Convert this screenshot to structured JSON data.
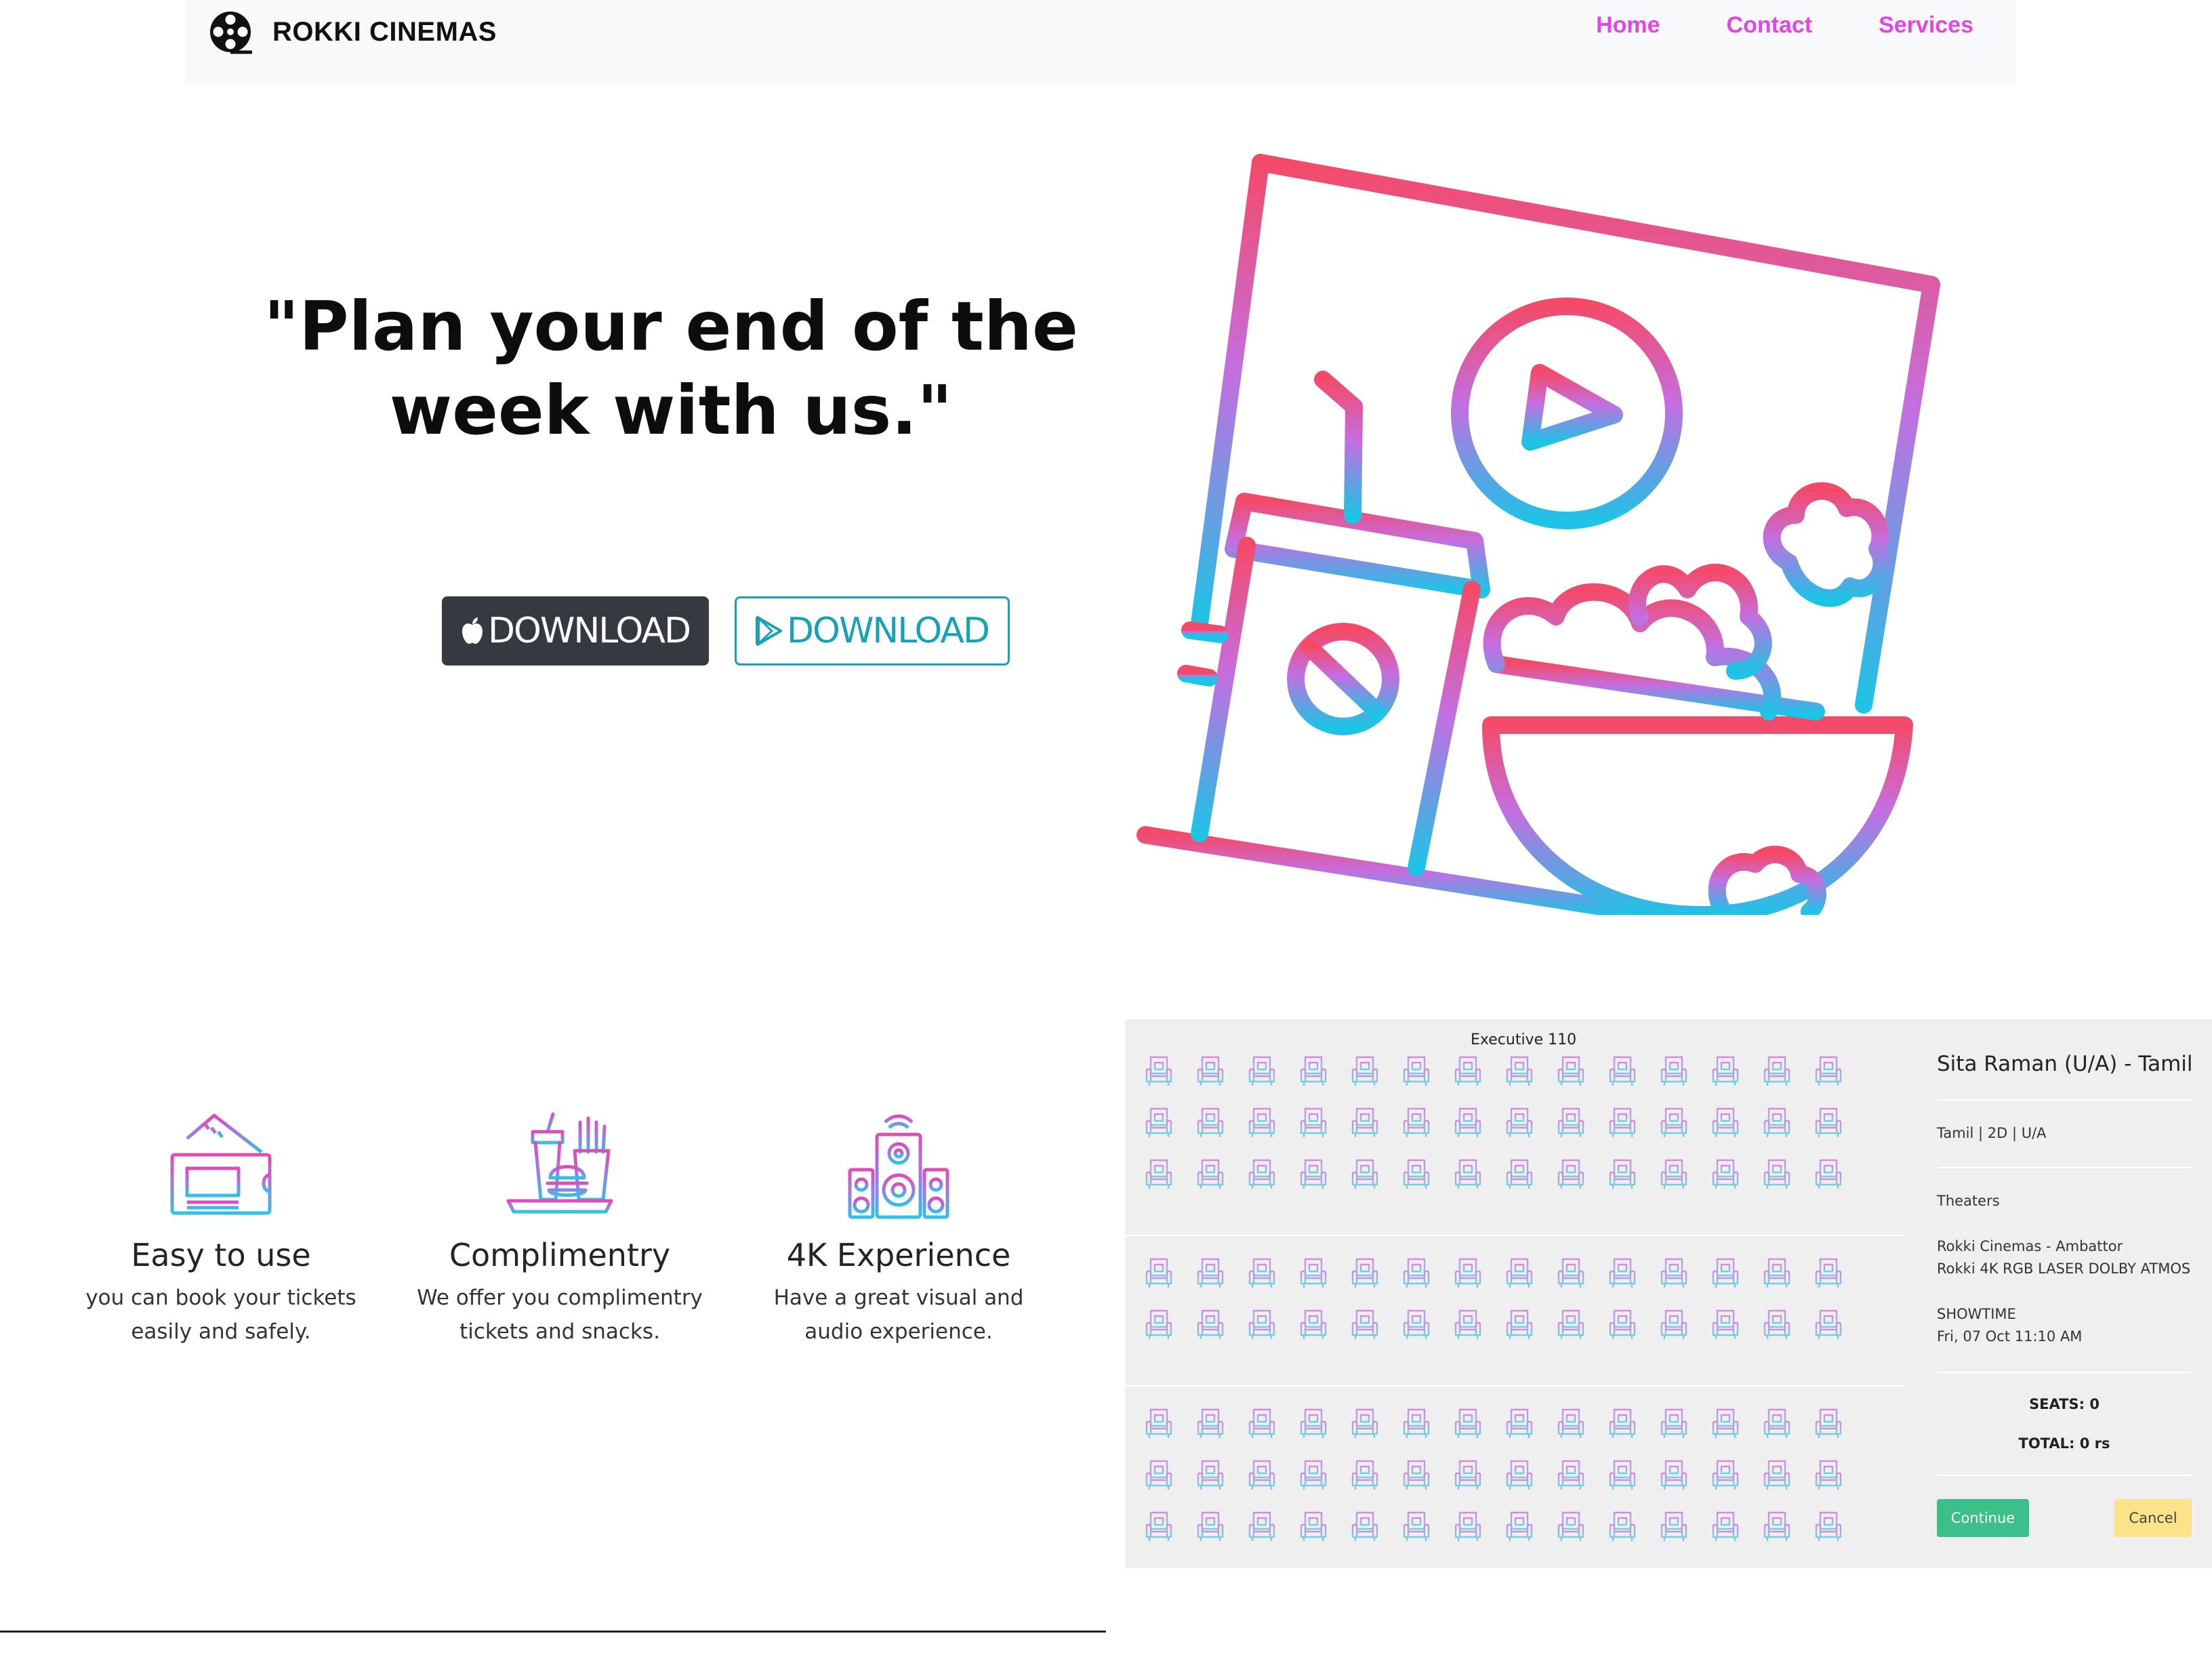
{
  "navbar": {
    "brand": "ROKKI CINEMAS",
    "links": [
      "Home",
      "Contact",
      "Services"
    ],
    "link_color": "#e645e6"
  },
  "hero": {
    "title": "\"Plan your end of the week with us.\"",
    "apple_button": "DOWNLOAD",
    "play_button": "DOWNLOAD",
    "illustration_icon": "cinema-illustration-icon"
  },
  "features": [
    {
      "icon": "ticket-icon",
      "title": "Easy to use",
      "text": "you can book your tickets easily and safely."
    },
    {
      "icon": "snacks-icon",
      "title": "Complimentry",
      "text": "We offer you complimentry tickets and snacks."
    },
    {
      "icon": "speaker-icon",
      "title": "4K Experience",
      "text": "Have a great visual and audio experience."
    }
  ],
  "booking": {
    "screen_label": "Executive 110",
    "seat_icon": "seat-icon",
    "seat_blocks": [
      3,
      2,
      3
    ],
    "seats_per_row": 14,
    "movie_title": "Sita Raman (U/A) - Tamil",
    "movie_meta": "Tamil | 2D | U/A",
    "theaters_label": "Theaters",
    "theater_name": "Rokki Cinemas - Ambattor",
    "theater_screen": "Rokki 4K RGB LASER DOLBY ATMOS",
    "showtime_label": "SHOWTIME",
    "showtime": "Fri, 07 Oct 11:10 AM",
    "seats": "SEATS: 0",
    "total": "TOTAL: 0 rs",
    "continue": "Continue",
    "cancel": "Cancel"
  },
  "colors": {
    "gradient_top": "#f44a6a",
    "gradient_mid": "#c46ee0",
    "gradient_bottom": "#1ec3e6",
    "continue": "#3cc08a",
    "cancel": "#fbe38a"
  }
}
